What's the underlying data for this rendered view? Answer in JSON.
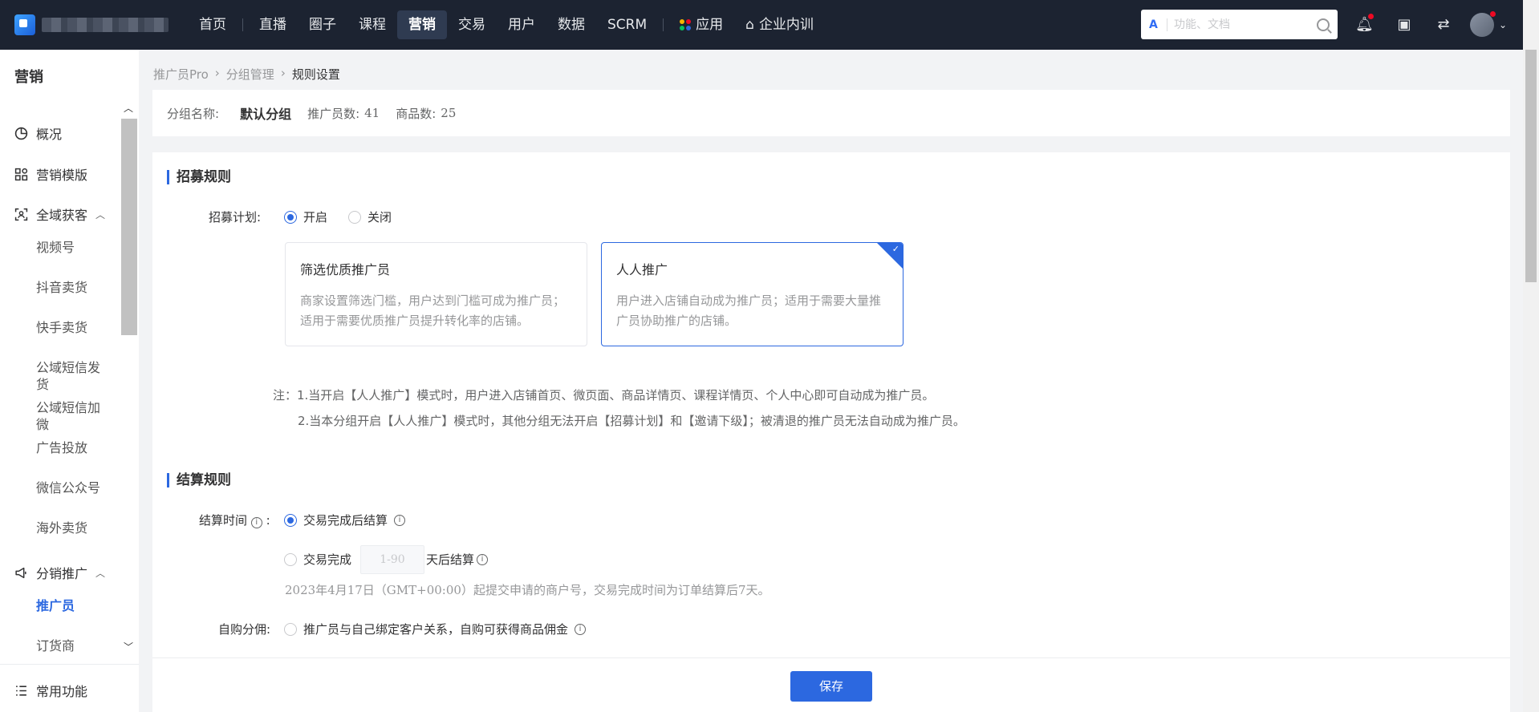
{
  "topnav": {
    "items": [
      "首页",
      "直播",
      "圈子",
      "课程",
      "营销",
      "交易",
      "用户",
      "数据",
      "SCRM",
      "应用",
      "企业内训"
    ],
    "active": "营销",
    "search_placeholder": "功能、文档"
  },
  "sidebar": {
    "title": "营销",
    "items": [
      {
        "label": "概况",
        "icon": "pie-chart-icon"
      },
      {
        "label": "营销模版",
        "icon": "grid-icon"
      },
      {
        "label": "全域获客",
        "icon": "scan-user-icon"
      },
      {
        "label": "分销推广",
        "icon": "megaphone-icon"
      },
      {
        "label": "常用功能",
        "icon": "list-icon"
      }
    ],
    "sub_acquire": [
      "视频号",
      "抖音卖货",
      "快手卖货",
      "公域短信发货",
      "公域短信加微",
      "广告投放",
      "微信公众号",
      "海外卖货"
    ],
    "sub_distribution": [
      "推广员",
      "订货商"
    ]
  },
  "breadcrumb": [
    "推广员Pro",
    "分组管理",
    "规则设置"
  ],
  "group": {
    "name_label": "分组名称:",
    "name": "默认分组",
    "promoters_label": "推广员数:",
    "promoters": "41",
    "goods_label": "商品数:",
    "goods": "25"
  },
  "recruit": {
    "title": "招募规则",
    "plan_label": "招募计划:",
    "opt_on": "开启",
    "opt_off": "关闭",
    "card1_title": "筛选优质推广员",
    "card1_desc": "商家设置筛选门槛，用户达到门槛可成为推广员；适用于需要优质推广员提升转化率的店铺。",
    "card2_title": "人人推广",
    "card2_desc": "用户进入店铺自动成为推广员；适用于需要大量推广员协助推广的店铺。",
    "note1": "注：1.当开启【人人推广】模式时，用户进入店铺首页、微页面、商品详情页、课程详情页、个人中心即可自动成为推广员。",
    "note2": "2.当本分组开启【人人推广】模式时，其他分组无法开启【招募计划】和【邀请下级】；被清退的推广员无法自动成为推广员。"
  },
  "settle": {
    "title": "结算规则",
    "time_label": "结算时间",
    "opt1": "交易完成后结算",
    "opt2_prefix": "交易完成",
    "days_placeholder": "1-90",
    "opt2_suffix": "天后结算",
    "hint": "2023年4月17日（GMT+00:00）起提交申请的商户号，交易完成时间为订单结算后7天。",
    "self_label": "自购分佣:",
    "self_opt": "推广员与自己绑定客户关系，自购可获得商品佣金"
  },
  "footer": {
    "save": "保存"
  },
  "colors": {
    "nav_bg": "#1c2331",
    "accent": "#2c68e0"
  }
}
